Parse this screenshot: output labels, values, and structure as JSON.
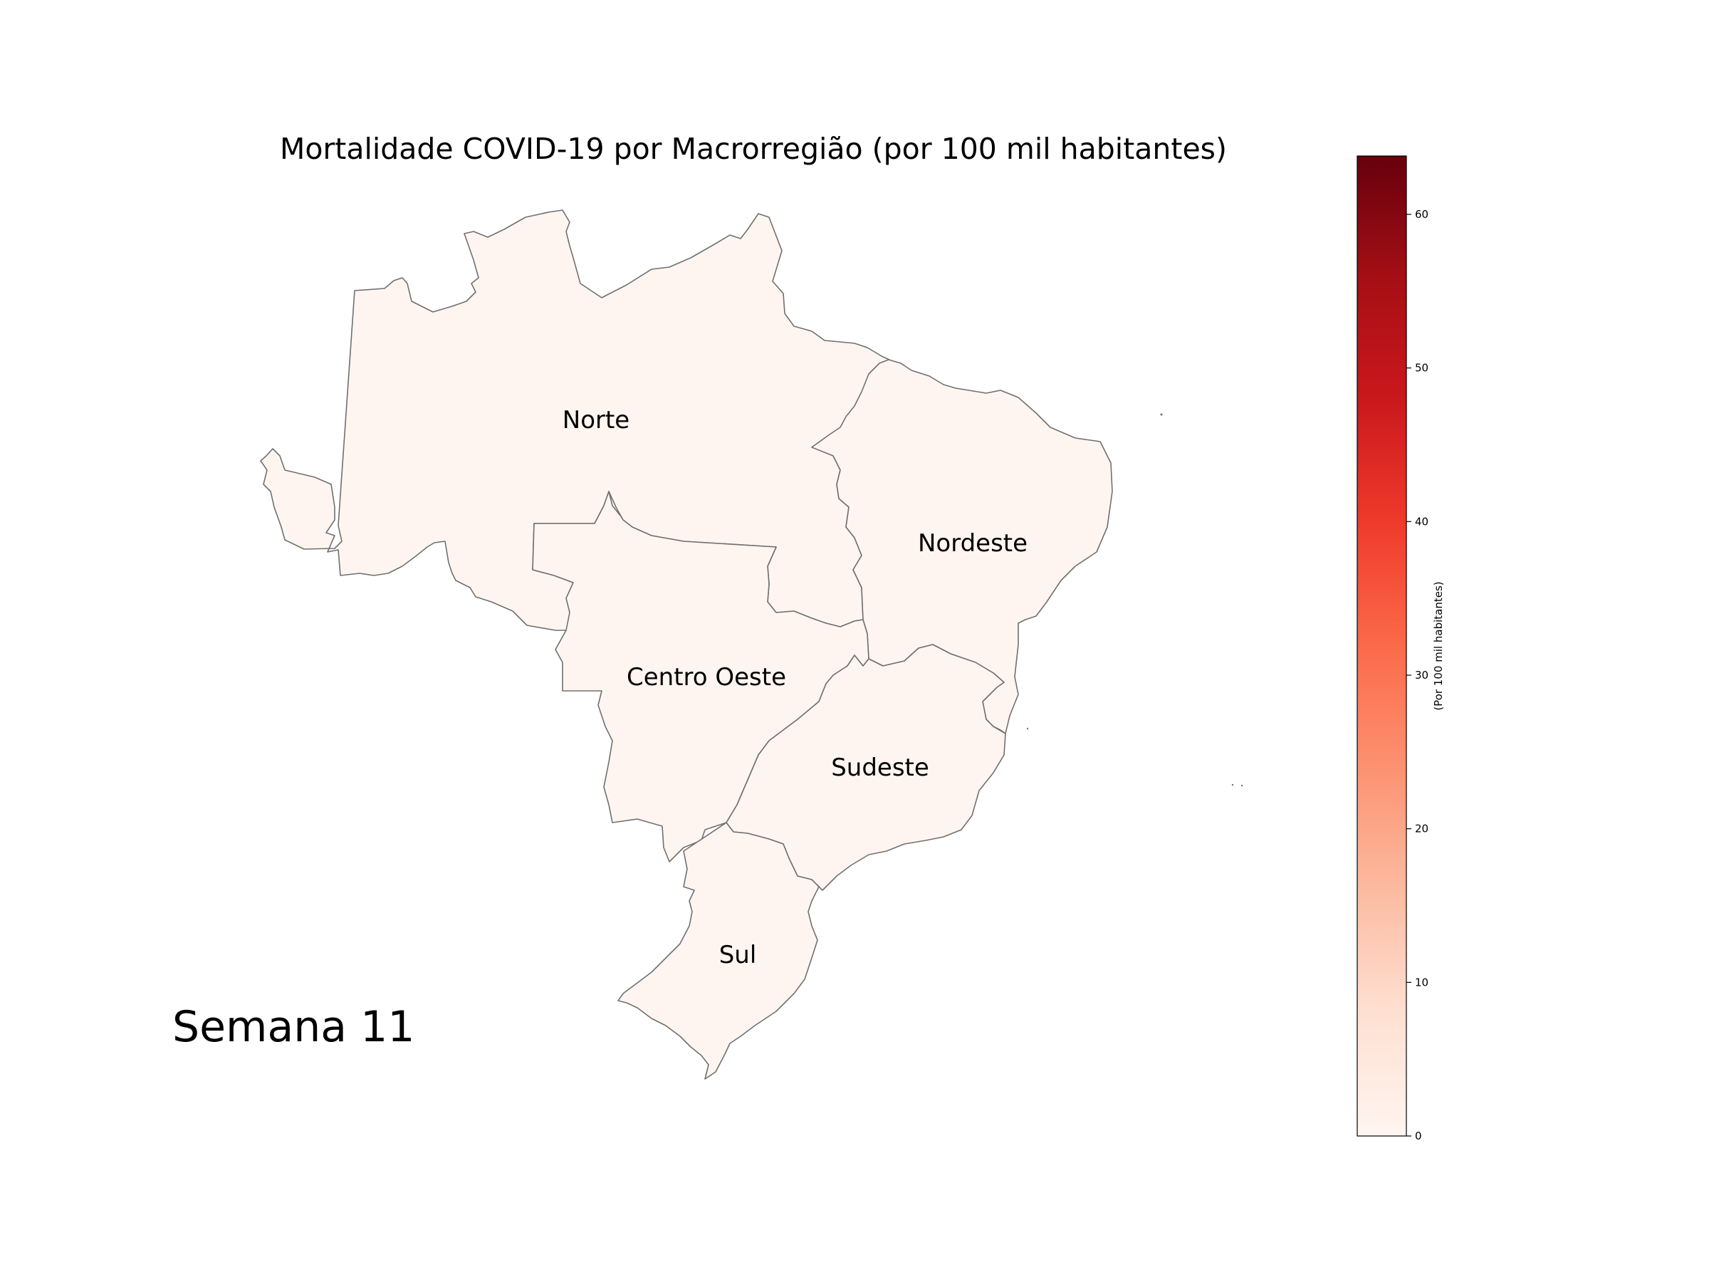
{
  "title": "Mortalidade COVID-19 por Macrorregião (por 100 mil habitantes)",
  "week_label": "Semana 11",
  "regions": [
    {
      "id": "norte",
      "name": "Norte",
      "value": 0
    },
    {
      "id": "nordeste",
      "name": "Nordeste",
      "value": 0
    },
    {
      "id": "centro-oeste",
      "name": "Centro Oeste",
      "value": 0
    },
    {
      "id": "sudeste",
      "name": "Sudeste",
      "value": 0
    },
    {
      "id": "sul",
      "name": "Sul",
      "value": 0
    }
  ],
  "colorbar": {
    "label": "(Por 100 mil habitantes)",
    "min": 0,
    "max": 63.8,
    "ticks": [
      0,
      10,
      20,
      30,
      40,
      50,
      60
    ],
    "colormap": "Reds",
    "color_stops": [
      "#fff5f0",
      "#fee0d2",
      "#fcbba1",
      "#fc9272",
      "#fb6a4a",
      "#ef3b2c",
      "#cb181d",
      "#a50f15",
      "#67000d"
    ]
  }
}
